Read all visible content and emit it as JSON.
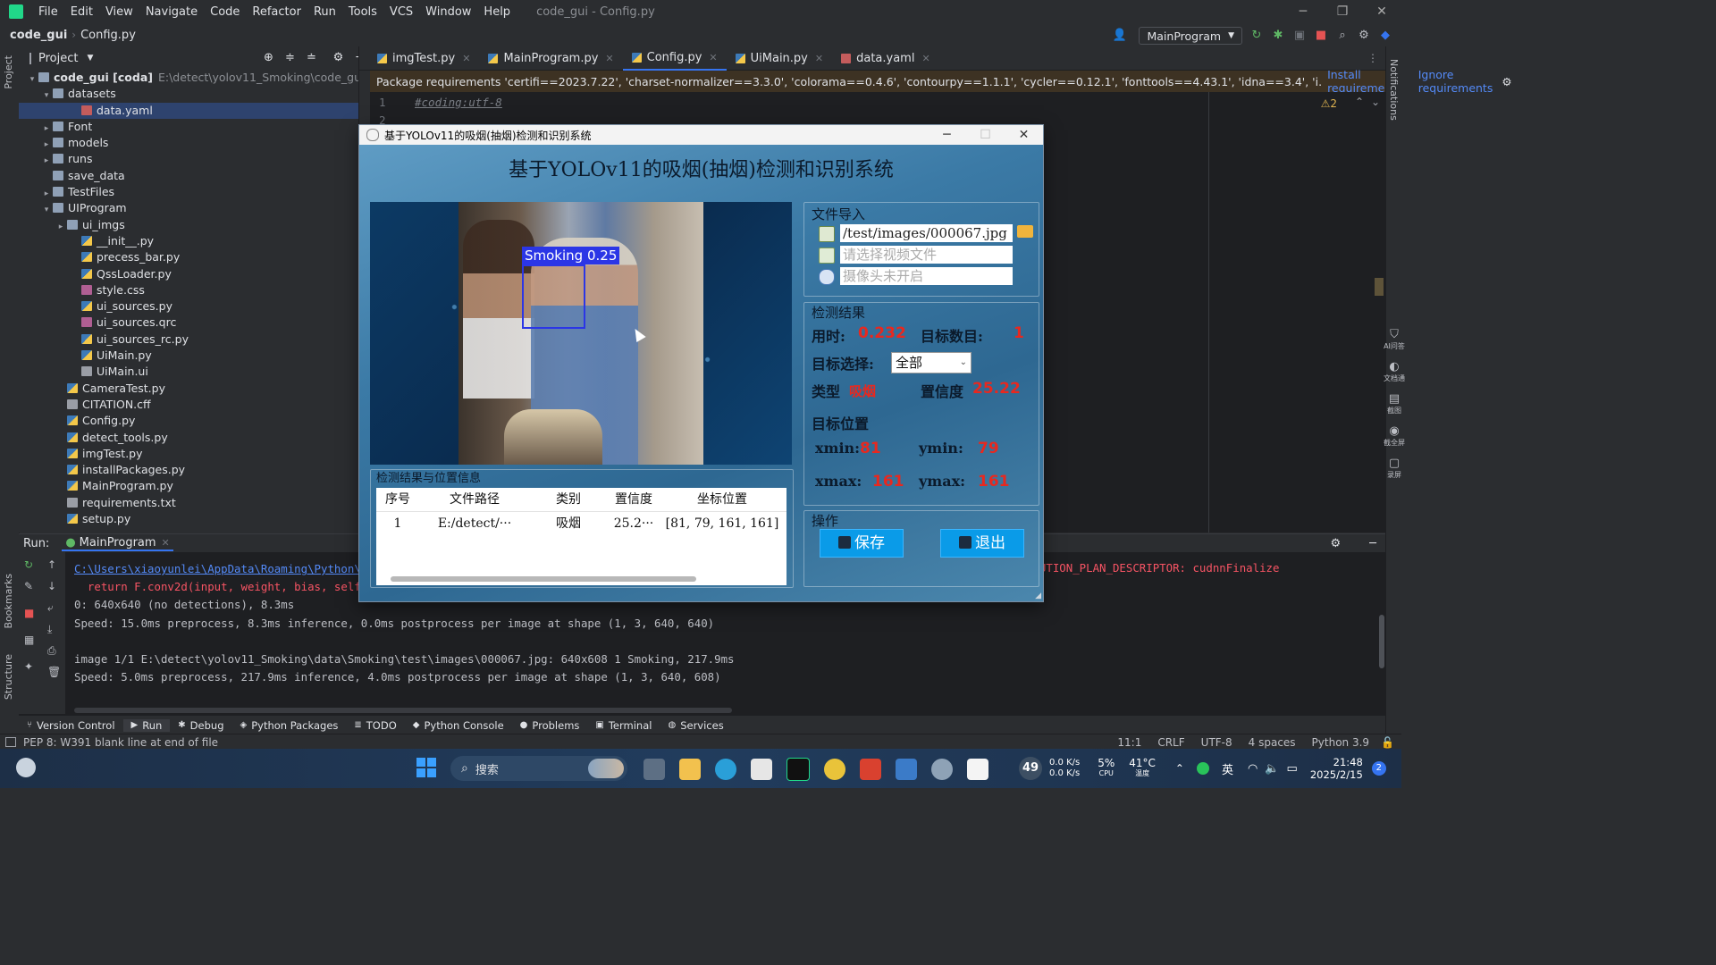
{
  "ide": {
    "menu": [
      "File",
      "Edit",
      "View",
      "Navigate",
      "Code",
      "Refactor",
      "Run",
      "Tools",
      "VCS",
      "Window",
      "Help"
    ],
    "window_title": "code_gui - Config.py",
    "breadcrumb_project": "code_gui",
    "breadcrumb_file": "Config.py",
    "run_config": "MainProgram",
    "project_label": "Project",
    "tree": [
      {
        "label": "code_gui [coda]",
        "path": "E:\\detect\\yolov11_Smoking\\code_gui",
        "indent": 0,
        "arrow": "▾",
        "icon": "folder"
      },
      {
        "label": "datasets",
        "indent": 1,
        "arrow": "▾",
        "icon": "folder"
      },
      {
        "label": "data.yaml",
        "indent": 3,
        "arrow": "",
        "icon": "yaml",
        "selected": true
      },
      {
        "label": "Font",
        "indent": 1,
        "arrow": "▸",
        "icon": "folder"
      },
      {
        "label": "models",
        "indent": 1,
        "arrow": "▸",
        "icon": "folder"
      },
      {
        "label": "runs",
        "indent": 1,
        "arrow": "▸",
        "icon": "folder"
      },
      {
        "label": "save_data",
        "indent": 1,
        "arrow": "",
        "icon": "folder"
      },
      {
        "label": "TestFiles",
        "indent": 1,
        "arrow": "▸",
        "icon": "folder"
      },
      {
        "label": "UIProgram",
        "indent": 1,
        "arrow": "▾",
        "icon": "folder"
      },
      {
        "label": "ui_imgs",
        "indent": 2,
        "arrow": "▸",
        "icon": "folder"
      },
      {
        "label": "__init__.py",
        "indent": 3,
        "arrow": "",
        "icon": "py"
      },
      {
        "label": "precess_bar.py",
        "indent": 3,
        "arrow": "",
        "icon": "py"
      },
      {
        "label": "QssLoader.py",
        "indent": 3,
        "arrow": "",
        "icon": "py"
      },
      {
        "label": "style.css",
        "indent": 3,
        "arrow": "",
        "icon": "css"
      },
      {
        "label": "ui_sources.py",
        "indent": 3,
        "arrow": "",
        "icon": "py"
      },
      {
        "label": "ui_sources.qrc",
        "indent": 3,
        "arrow": "",
        "icon": "css"
      },
      {
        "label": "ui_sources_rc.py",
        "indent": 3,
        "arrow": "",
        "icon": "py"
      },
      {
        "label": "UiMain.py",
        "indent": 3,
        "arrow": "",
        "icon": "py"
      },
      {
        "label": "UiMain.ui",
        "indent": 3,
        "arrow": "",
        "icon": "txt"
      },
      {
        "label": "CameraTest.py",
        "indent": 2,
        "arrow": "",
        "icon": "py"
      },
      {
        "label": "CITATION.cff",
        "indent": 2,
        "arrow": "",
        "icon": "txt"
      },
      {
        "label": "Config.py",
        "indent": 2,
        "arrow": "",
        "icon": "py"
      },
      {
        "label": "detect_tools.py",
        "indent": 2,
        "arrow": "",
        "icon": "py"
      },
      {
        "label": "imgTest.py",
        "indent": 2,
        "arrow": "",
        "icon": "py"
      },
      {
        "label": "installPackages.py",
        "indent": 2,
        "arrow": "",
        "icon": "py"
      },
      {
        "label": "MainProgram.py",
        "indent": 2,
        "arrow": "",
        "icon": "py"
      },
      {
        "label": "requirements.txt",
        "indent": 2,
        "arrow": "",
        "icon": "txt"
      },
      {
        "label": "setup.py",
        "indent": 2,
        "arrow": "",
        "icon": "py"
      }
    ],
    "tabs": [
      {
        "label": "imgTest.py",
        "active": false
      },
      {
        "label": "MainProgram.py",
        "active": false
      },
      {
        "label": "Config.py",
        "active": true
      },
      {
        "label": "UiMain.py",
        "active": false
      },
      {
        "label": "data.yaml",
        "active": false
      }
    ],
    "banner": {
      "text": "Package requirements 'certifi==2023.7.22', 'charset-normalizer==3.3.0', 'colorama==0.4.6', 'contourpy==1.1.1', 'cycler==0.12.1', 'fonttools==4.43.1', 'idna==3.4', 'i.",
      "install": "Install requirements",
      "ignore": "Ignore requirements"
    },
    "editor": {
      "line1_no": "1",
      "line1": "#coding:utf-8",
      "line2_no": "2",
      "warnings": "⚠2"
    },
    "run": {
      "label": "Run:",
      "config": "MainProgram",
      "lines": [
        {
          "text": "C:\\Users\\xiaoyunlei\\AppData\\Roaming\\Python\\",
          "type": "link"
        },
        {
          "text": "  return F.conv2d(input, weight, bias, self",
          "type": "err"
        },
        {
          "text": "0: 640x640 (no detections), 8.3ms",
          "type": "normal"
        },
        {
          "text": "Speed: 15.0ms preprocess, 8.3ms inference, 0.0ms postprocess per image at shape (1, 3, 640, 640)",
          "type": "normal"
        },
        {
          "text": "",
          "type": "blank"
        },
        {
          "text": "image 1/1 E:\\detect\\yolov11_Smoking\\data\\Smoking\\test\\images\\000067.jpg: 640x608 1 Smoking, 217.9ms",
          "type": "normal"
        },
        {
          "text": "Speed: 5.0ms preprocess, 217.9ms inference, 4.0ms postprocess per image at shape (1, 3, 640, 608)",
          "type": "normal"
        }
      ],
      "right_err": "NN_BACKEND_EXECUTION_PLAN_DESCRIPTOR: cudnnFinalize"
    },
    "tool_tabs": [
      "Version Control",
      "Run",
      "Debug",
      "Python Packages",
      "TODO",
      "Python Console",
      "Problems",
      "Terminal",
      "Services"
    ],
    "left_strip": [
      "Project",
      "Bookmarks",
      "Structure"
    ],
    "right_strip": [
      "Notifications"
    ],
    "right_tools": [
      "AI问答",
      "文档通",
      "截图",
      "截全屏",
      "录屏"
    ],
    "status_left": "PEP 8: W391 blank line at end of file",
    "status_right": [
      "11:1",
      "CRLF",
      "UTF-8",
      "4 spaces",
      "Python 3.9"
    ]
  },
  "app": {
    "window_title": "基于YOLOv11的吸烟(抽烟)检测和识别系统",
    "title": "基于YOLOv11的吸烟(抽烟)检测和识别系统",
    "bbox_label": "Smoking 0.25",
    "table_group": "检测结果与位置信息",
    "table_headers": [
      "序号",
      "文件路径",
      "类别",
      "置信度",
      "坐标位置"
    ],
    "table_rows": [
      [
        "1",
        "E:/detect/···",
        "吸烟",
        "25.2···",
        "[81, 79, 161, 161]"
      ]
    ],
    "file_group": "文件导入",
    "image_path": "/test/images/000067.jpg",
    "video_placeholder": "请选择视频文件",
    "camera_placeholder": "摄像头未开启",
    "result_group": "检测结果",
    "time_label": "用时:",
    "time_value": "0.232",
    "count_label": "目标数目:",
    "count_value": "1",
    "select_label": "目标选择:",
    "select_value": "全部",
    "type_label": "类型",
    "type_value": "吸烟",
    "conf_label": "置信度",
    "conf_value": "25.22",
    "pos_label": "目标位置",
    "xmin_label": "xmin:",
    "xmin": "81",
    "ymin_label": "ymin:",
    "ymin": "79",
    "xmax_label": "xmax:",
    "xmax": "161",
    "ymax_label": "ymax:",
    "ymax": "161",
    "op_group": "操作",
    "save_btn": "保存",
    "exit_btn": "退出"
  },
  "taskbar": {
    "search": "搜索",
    "weather": "49",
    "net_up": "0.0 K/s",
    "net_down": "0.0 K/s",
    "cpu": "5%",
    "cpu_label": "CPU",
    "temp": "41°C",
    "temp_label": "温度",
    "ime": "英",
    "time": "21:48",
    "date": "2025/2/15",
    "notif": "2"
  }
}
